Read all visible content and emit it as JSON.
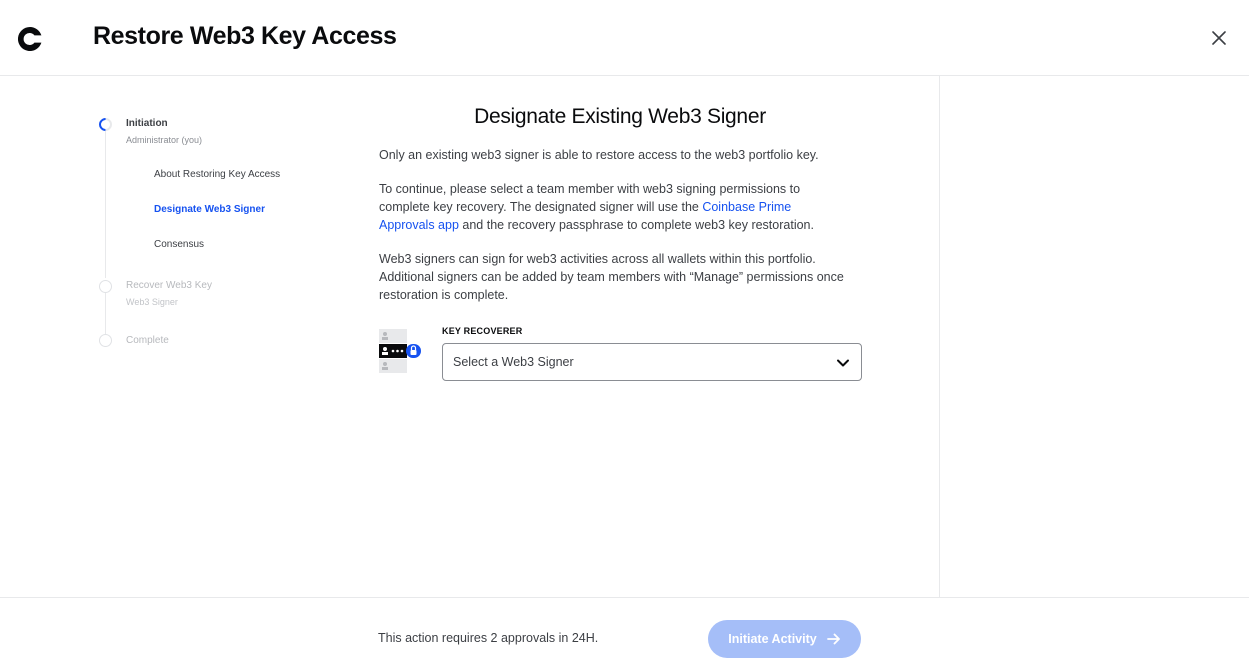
{
  "header": {
    "title": "Restore Web3 Key Access",
    "logo_icon": "coinbase-c-logo",
    "close_icon": "close-icon"
  },
  "stepper": {
    "steps": [
      {
        "title": "Initiation",
        "subtitle": "Administrator (you)",
        "state": "active",
        "substeps": [
          {
            "label": "About Restoring Key Access",
            "state": "done"
          },
          {
            "label": "Designate Web3 Signer",
            "state": "current"
          },
          {
            "label": "Consensus",
            "state": "upcoming"
          }
        ]
      },
      {
        "title": "Recover Web3 Key",
        "subtitle": "Web3 Signer",
        "state": "upcoming"
      },
      {
        "title": "Complete",
        "state": "upcoming"
      }
    ]
  },
  "main": {
    "title": "Designate Existing Web3 Signer",
    "para1": "Only an existing web3 signer is able to restore access to the web3 portfolio key.",
    "para2_before": "To continue, please select a team member with web3 signing permissions to complete key recovery. The designated signer will use the ",
    "para2_link": "Coinbase Prime Approvals app",
    "para2_after": " and the recovery passphrase to complete web3 key restoration.",
    "para3": "Web3 signers can sign for web3 activities across all wallets within this portfolio. Additional signers can be added by team members with “Manage” permissions once restoration is complete.",
    "key_recoverer": {
      "label": "KEY RECOVERER",
      "placeholder": "Select a Web3 Signer",
      "illustration_icon": "key-recoverer-icon",
      "chevron_icon": "chevron-down-icon"
    }
  },
  "footer": {
    "note": "This action requires 2 approvals in 24H.",
    "primary_button": "Initiate Activity",
    "primary_button_state": "disabled",
    "arrow_icon": "arrow-right-icon"
  },
  "colors": {
    "accent": "#1652f0",
    "button_disabled": "#a5bef8",
    "border": "#e8e9eb",
    "text": "#0a0b0d"
  }
}
